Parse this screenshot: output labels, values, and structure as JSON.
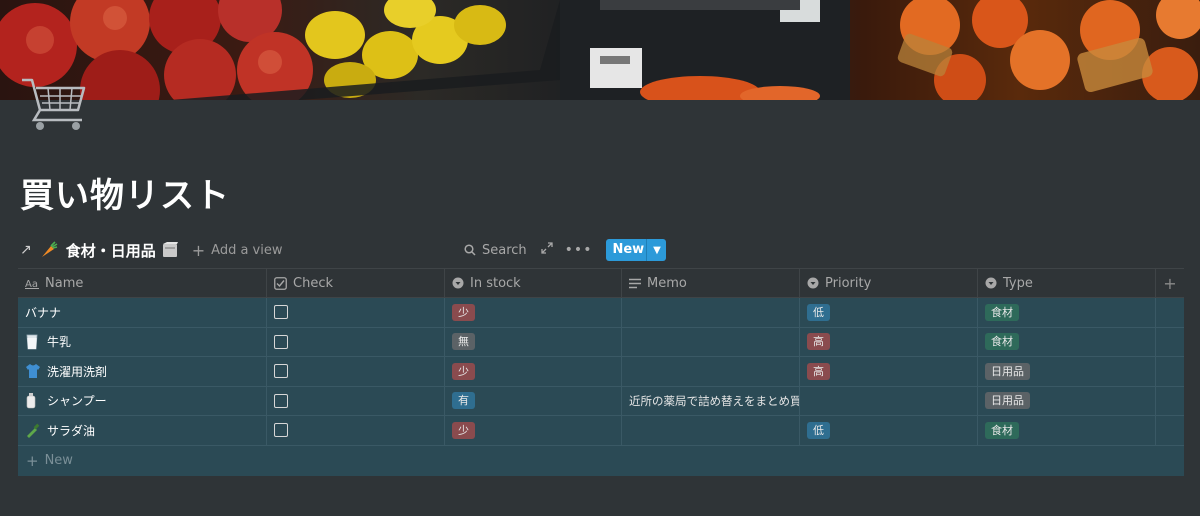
{
  "page": {
    "title": "買い物リスト",
    "cover_description": "supermarket produce"
  },
  "database": {
    "title": "食材・日用品",
    "add_view_label": "Add a view",
    "toolbar": {
      "search_label": "Search",
      "new_label": "New"
    },
    "columns": [
      {
        "label": "Name",
        "icon": "text-icon"
      },
      {
        "label": "Check",
        "icon": "checkbox-icon"
      },
      {
        "label": "In stock",
        "icon": "select-icon"
      },
      {
        "label": "Memo",
        "icon": "lines-icon"
      },
      {
        "label": "Priority",
        "icon": "select-icon"
      },
      {
        "label": "Type",
        "icon": "select-icon"
      }
    ],
    "rows": [
      {
        "name": "バナナ",
        "emoji": "",
        "checked": false,
        "stock": "少",
        "stock_color": "red",
        "memo": "",
        "priority": "低",
        "priority_color": "blue",
        "type": "食材",
        "type_color": "green"
      },
      {
        "name": "牛乳",
        "emoji": "milk-glass-icon",
        "checked": false,
        "stock": "無",
        "stock_color": "gray",
        "memo": "",
        "priority": "高",
        "priority_color": "red",
        "type": "食材",
        "type_color": "green"
      },
      {
        "name": "洗濯用洗剤",
        "emoji": "tshirt-icon",
        "checked": false,
        "stock": "少",
        "stock_color": "red",
        "memo": "",
        "priority": "高",
        "priority_color": "red",
        "type": "日用品",
        "type_color": "gray"
      },
      {
        "name": "シャンプー",
        "emoji": "bottle-icon",
        "checked": false,
        "stock": "有",
        "stock_color": "blue",
        "memo": "近所の薬局で詰め替えをまとめ買",
        "priority": "",
        "priority_color": "",
        "type": "日用品",
        "type_color": "gray"
      },
      {
        "name": "サラダ油",
        "emoji": "oil-bottle-icon",
        "checked": false,
        "stock": "少",
        "stock_color": "red",
        "memo": "",
        "priority": "低",
        "priority_color": "blue",
        "type": "食材",
        "type_color": "green"
      }
    ],
    "new_row_label": "New"
  }
}
